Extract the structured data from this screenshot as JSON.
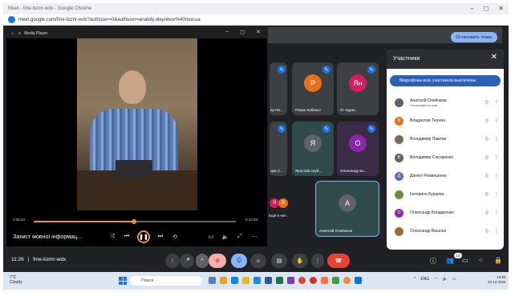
{
  "browser": {
    "tab_title": "Meet - fme-bzmr-wdx - Google Chrome",
    "url": "meet.google.com/fme-bzmr-wdx?authuser=0&authuser=anatoly.oleynikov%40nuw.ua"
  },
  "meet": {
    "stop_share_label": "Остановить показ",
    "time": "11:26",
    "separator": "|",
    "meeting_code": "fme-bzmr-wdx",
    "participants_badge": "14"
  },
  "tiles": [
    {
      "name": "ер Па...",
      "initial": "",
      "color": "#7a5a3a"
    },
    {
      "name": "Роман Кибенко",
      "initial": "Р",
      "color": "#e8711a"
    },
    {
      "name": "Я+ Бурис",
      "initial": "Ян",
      "color": "#d81b60"
    },
    {
      "name": "ора С...",
      "initial": "",
      "color": "#3c4043"
    },
    {
      "name": "Ярослав Скуб...",
      "initial": "Я",
      "color": "#5f6368"
    },
    {
      "name": "Олександр Бо...",
      "initial": "О",
      "color": "#8e24aa"
    },
    {
      "name": "Ещё 6 чел.",
      "initial": "Я",
      "color": "#d81b60"
    },
    {
      "name": "Анатолій Олейніков",
      "initial": "А",
      "color": "#5f6368"
    }
  ],
  "participants_panel": {
    "title": "Участники",
    "mute_banner": "Микрофоны всех участников выключены",
    "rows": [
      {
        "name": "Анатолій Олейніков",
        "sub": "Показывается вам",
        "initial": "",
        "color": "#5f6368"
      },
      {
        "name": "Владислав Терзіян",
        "sub": "",
        "initial": "В",
        "color": "#e8711a"
      },
      {
        "name": "Володимир Павлов",
        "sub": "",
        "initial": "",
        "color": "#7a6a5a"
      },
      {
        "name": "Володимир Слісаренко",
        "sub": "",
        "initial": "В",
        "color": "#5f6368"
      },
      {
        "name": "Даниїл Романценко",
        "sub": "",
        "initial": "Д",
        "color": "#5c6bc0"
      },
      {
        "name": "Катерина Бурцева",
        "sub": "",
        "initial": "",
        "color": "#6d8f3a"
      },
      {
        "name": "Олександр Бондаренко",
        "sub": "",
        "initial": "О",
        "color": "#8e24aa"
      },
      {
        "name": "Олександр Вишнєв",
        "sub": "",
        "initial": "",
        "color": "#9a6a3a"
      }
    ]
  },
  "media_player": {
    "title": "Media Player",
    "current_time": "0:06:24",
    "total_time": "0:12:53",
    "progress": 0.4967,
    "track_title": "Захист мовної інформац..."
  },
  "taskbar": {
    "weather_temp": "7°C",
    "weather_desc": "Cloudy",
    "search_placeholder": "Поиск",
    "lang": "ENG",
    "clock_time": "13:26",
    "clock_date": "23.12.2025"
  },
  "colors": {
    "meet_bg": "#202124",
    "accent_blue": "#8ab4f8",
    "end_call_red": "#ea4335",
    "player_accent": "#f28b3c"
  }
}
